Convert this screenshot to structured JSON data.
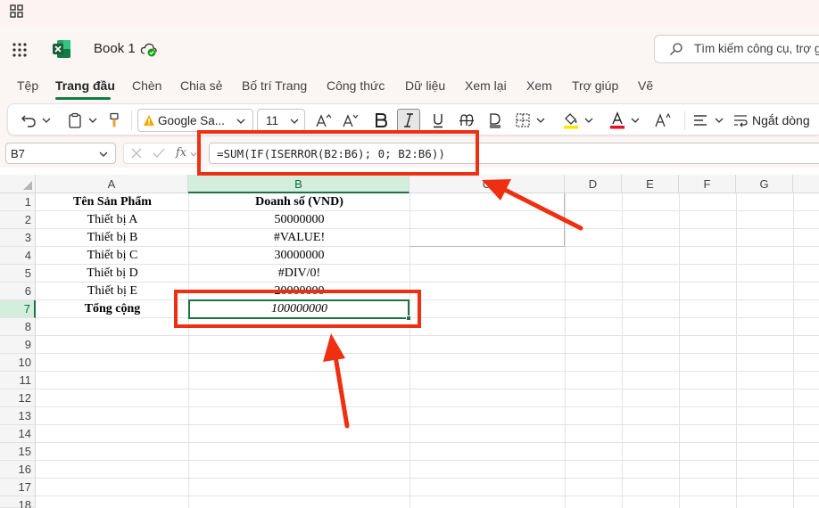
{
  "app": {
    "book_title": "Book 1",
    "search_placeholder": "Tìm kiếm công cụ, trợ giúp"
  },
  "menu": {
    "items": [
      "Tệp",
      "Trang đầu",
      "Chèn",
      "Chia sẻ",
      "Bố trí Trang",
      "Công thức",
      "Dữ liệu",
      "Xem lại",
      "Xem",
      "Trợ giúp",
      "Vẽ"
    ],
    "active": "Trang đầu"
  },
  "ribbon": {
    "font_name": "Google Sa...",
    "font_size": "11",
    "wrap_text_label": "Ngắt dòng"
  },
  "formula_bar": {
    "name_box": "B7",
    "fx_label": "fx",
    "formula": "=SUM(IF(ISERROR(B2:B6); 0; B2:B6))"
  },
  "sheet": {
    "columns": [
      "A",
      "B",
      "C",
      "D",
      "E",
      "F",
      "G"
    ],
    "selected_column": "B",
    "selected_row": "7",
    "rows": [
      "1",
      "2",
      "3",
      "4",
      "5",
      "6",
      "7",
      "8",
      "9",
      "10",
      "11",
      "12",
      "13",
      "14",
      "15",
      "16",
      "17",
      "18"
    ],
    "cells": [
      {
        "a": "Tên Sản Phẩm",
        "b": "Doanh số (VND)"
      },
      {
        "a": "Thiết bị A",
        "b": "50000000"
      },
      {
        "a": "Thiết bị B",
        "b": "#VALUE!"
      },
      {
        "a": "Thiết bị C",
        "b": "30000000"
      },
      {
        "a": "Thiết bị D",
        "b": "#DIV/0!"
      },
      {
        "a": "Thiết bị E",
        "b": "20000000"
      },
      {
        "a": "Tổng cộng",
        "b": "100000000"
      }
    ]
  },
  "colors": {
    "accent_green": "#1e7145",
    "annotation_red": "#ef2f12"
  }
}
